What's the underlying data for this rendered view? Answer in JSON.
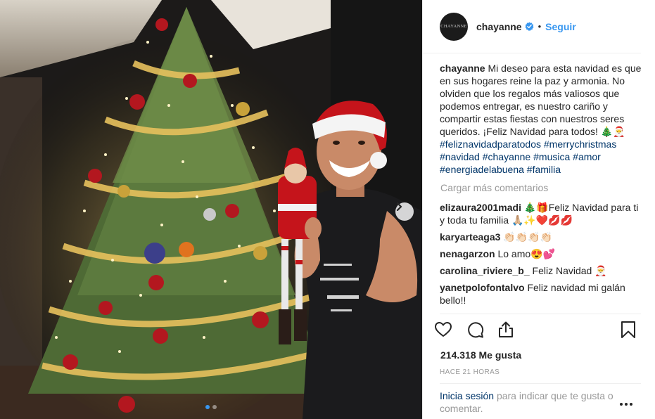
{
  "post": {
    "username": "chayanne",
    "verified": true,
    "follow_label": "Seguir",
    "avatar_text": "CHAYANNE",
    "separator": "•"
  },
  "caption": {
    "username": "chayanne",
    "text": "Mi deseo para esta navidad es que en sus hogares reine la paz y armonia. No olviden que los regalos más valiosos que podemos entregar, es nuestro cariño y compartir estas fiestas con nuestros seres queridos. ¡Feliz Navidad para todos! 🎄🎅",
    "hashtags": [
      "#feliznavidadparatodos",
      "#merrychristmas",
      "#navidad",
      "#chayanne",
      "#musica",
      "#amor",
      "#energiadelabuena",
      "#familia"
    ]
  },
  "load_more": "Cargar más comentarios",
  "comments": [
    {
      "username": "elizaura2001madi",
      "text": "🎄🎁Feliz Navidad para ti y toda tu familia 🙏🏼✨❤️💋💋"
    },
    {
      "username": "karyarteaga3",
      "text": "👏🏻👏🏻👏🏻👏🏻"
    },
    {
      "username": "nenagarzon",
      "text": "Lo amo😍💕"
    },
    {
      "username": "carolina_riviere_b_",
      "text": "Feliz Navidad 🎅"
    },
    {
      "username": "yanetpolofontalvo",
      "text": "Feliz navidad mi galán bello!!"
    }
  ],
  "likes": "214.318 Me gusta",
  "timestamp": "HACE 21 HORAS",
  "login_prompt": {
    "link": "Inicia sesión",
    "text": "para indicar que te gusta o comentar."
  },
  "carousel": {
    "count": 2,
    "active_index": 0
  },
  "icons": {
    "like": "heart-icon",
    "comment": "comment-icon",
    "share": "share-icon",
    "save": "bookmark-icon",
    "more": "more-options-icon",
    "next": "chevron-right-icon",
    "verified": "verified-badge-icon"
  },
  "colors": {
    "accent": "#3897f0",
    "text": "#262626",
    "muted": "#999999",
    "hashtag": "#003569",
    "divider": "#efefef"
  }
}
